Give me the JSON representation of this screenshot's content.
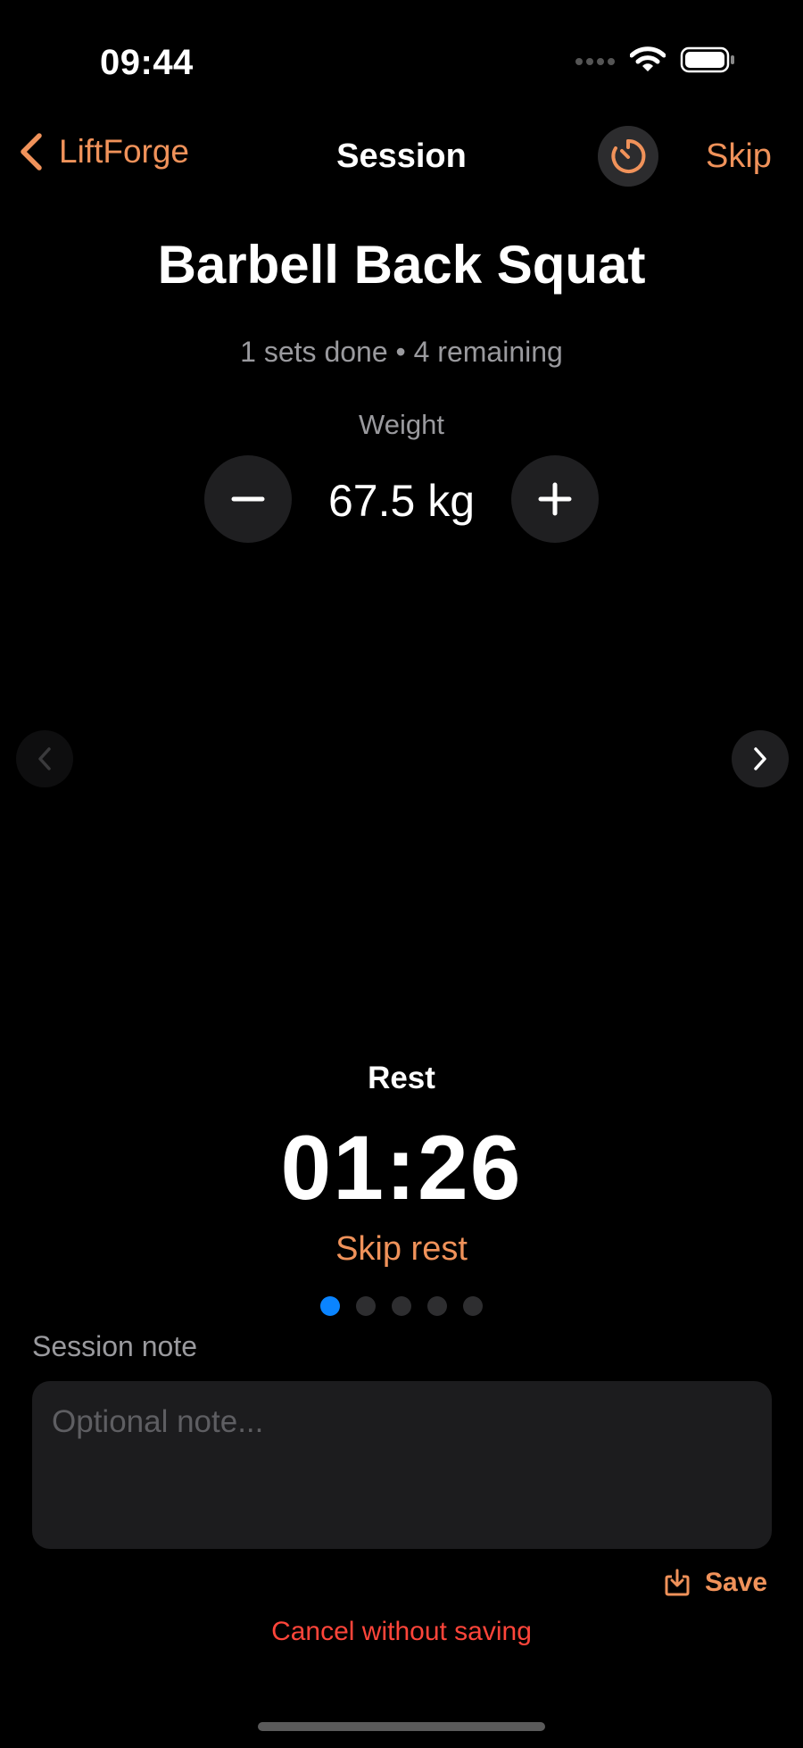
{
  "status_bar": {
    "time": "09:44"
  },
  "nav": {
    "back_label": "LiftForge",
    "title": "Session",
    "skip_label": "Skip"
  },
  "exercise": {
    "name": "Barbell Back Squat",
    "progress": "1 sets done • 4 remaining",
    "weight_label": "Weight",
    "weight_value": "67.5 kg"
  },
  "rest": {
    "label": "Rest",
    "time": "01:26",
    "skip_label": "Skip rest"
  },
  "pager": {
    "total": 5,
    "current": 1
  },
  "note": {
    "label": "Session note",
    "placeholder": "Optional note...",
    "value": ""
  },
  "actions": {
    "save_label": "Save",
    "cancel_label": "Cancel without saving"
  },
  "colors": {
    "accent": "#F0925A",
    "active_dot": "#0A84FF",
    "destructive": "#FF453A"
  },
  "icons": [
    "cellular-signal-icon",
    "wifi-icon",
    "battery-icon",
    "chevron-left-icon",
    "timer-icon",
    "minus-icon",
    "plus-icon",
    "chevron-right-icon",
    "save-icon"
  ]
}
